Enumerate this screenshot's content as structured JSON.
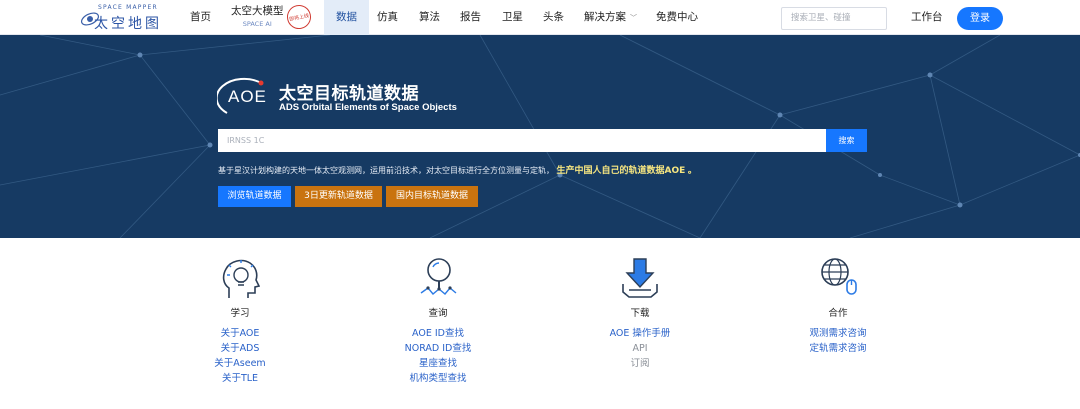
{
  "nav": {
    "logo_en": "SPACE MAPPER",
    "logo_zh": "太空地图",
    "items": [
      {
        "label": "首页"
      },
      {
        "label": "太空大模型",
        "sub": "SPACE AI",
        "badge": "即将上线"
      },
      {
        "label": "数据",
        "active": true
      },
      {
        "label": "仿真"
      },
      {
        "label": "算法"
      },
      {
        "label": "报告"
      },
      {
        "label": "卫星"
      },
      {
        "label": "头条"
      },
      {
        "label": "解决方案",
        "caret": "﹀"
      },
      {
        "label": "免费中心"
      }
    ],
    "search_placeholder": "搜索卫星、碰撞",
    "workbench": "工作台",
    "login": "登录"
  },
  "hero": {
    "logo_text": "AOE",
    "title": "太空目标轨道数据",
    "subtitle": "ADS Orbital Elements of Space Objects",
    "search_placeholder": "IRNSS 1C",
    "search_button": "搜索",
    "desc_plain": "基于星汉计划构建的天地一体太空观测网，运用前沿技术，对太空目标进行全方位测量与定轨，",
    "desc_highlight": "生产中国人自己的轨道数据AOE",
    "desc_end": "。",
    "buttons": [
      "浏览轨道数据",
      "3日更新轨道数据",
      "国内目标轨道数据"
    ]
  },
  "features": [
    {
      "icon": "head-lightbulb-icon",
      "title": "学习",
      "links": [
        "关于AOE",
        "关于ADS",
        "关于Aseem",
        "关于TLE"
      ]
    },
    {
      "icon": "magnifier-icon",
      "title": "查询",
      "links": [
        "AOE ID查找",
        "NORAD ID查找",
        "星座查找",
        "机构类型查找"
      ]
    },
    {
      "icon": "download-icon",
      "title": "下载",
      "links": [
        "AOE 操作手册",
        "API",
        "订阅"
      ]
    },
    {
      "icon": "globe-mouse-icon",
      "title": "合作",
      "links": [
        "观测需求咨询",
        "定轨需求咨询"
      ]
    }
  ],
  "colors": {
    "primary": "#1677ff",
    "hero_bg": "#163a63",
    "orange": "#c9730f",
    "link": "#2a62c9"
  }
}
